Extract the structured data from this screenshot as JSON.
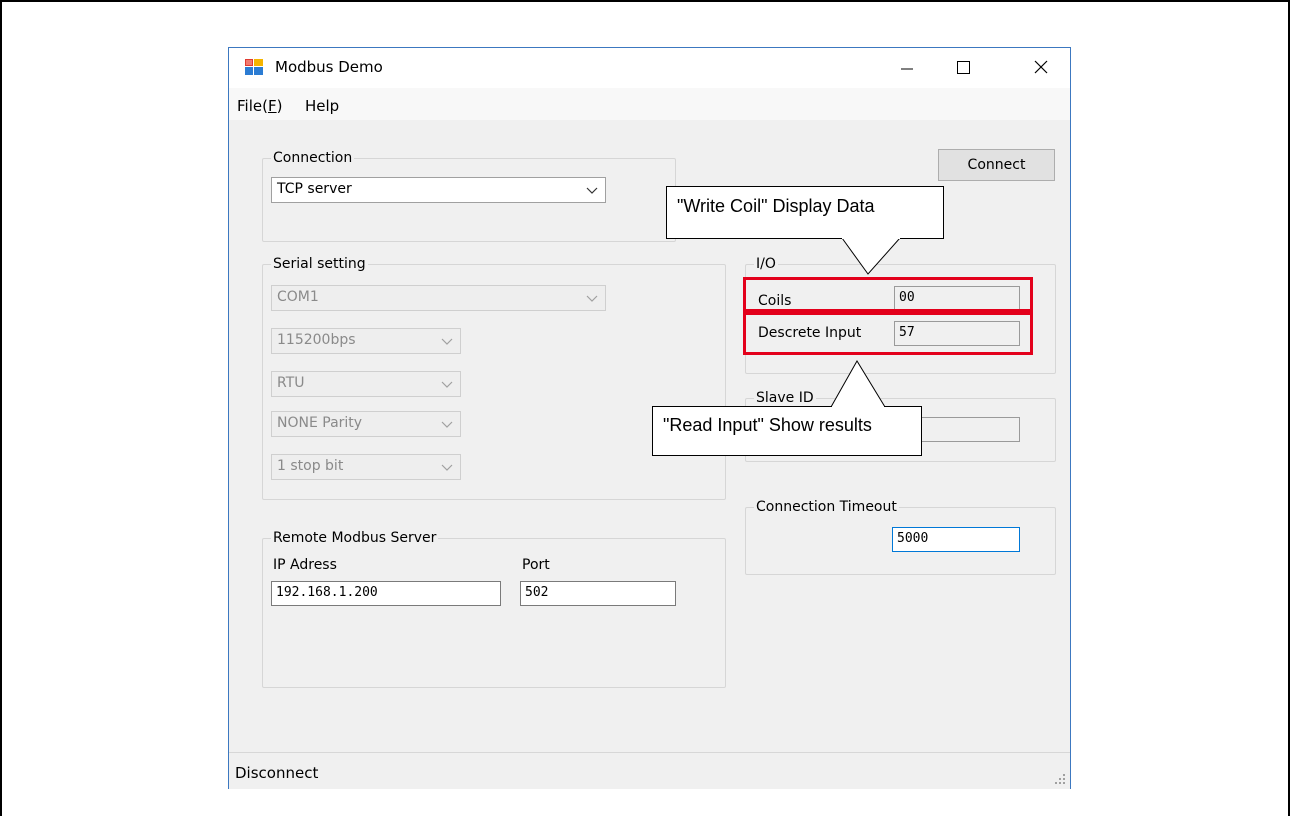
{
  "window": {
    "title": "Modbus Demo",
    "controls": [
      "minimize",
      "maximize",
      "close"
    ]
  },
  "menu": {
    "file_label": "File(F)",
    "file_prefix": "File(",
    "file_accel": "F",
    "file_suffix": ")",
    "help_label": "Help"
  },
  "connection": {
    "group_title": "Connection",
    "selected": "TCP server",
    "connect_button": "Connect"
  },
  "serial": {
    "group_title": "Serial setting",
    "port": "COM1",
    "baud": "115200bps",
    "mode": "RTU",
    "parity": "NONE Parity",
    "stop_bits": "1 stop bit"
  },
  "remote": {
    "group_title": "Remote Modbus Server",
    "ip_label": "IP Adress",
    "ip_value": "192.168.1.200",
    "port_label": "Port",
    "port_value": "502"
  },
  "io": {
    "group_title": "I/O",
    "coils_label": "Coils",
    "coils_value": "00",
    "input_label": "Descrete Input",
    "input_value": "57"
  },
  "slave": {
    "group_title": "Slave ID",
    "value": ""
  },
  "timeout": {
    "group_title": "Connection Timeout",
    "value": "5000"
  },
  "status": {
    "text": "Disconnect"
  },
  "annotations": {
    "write_coil": "\"Write Coil\" Display Data",
    "read_input": "\"Read Input\" Show results",
    "highlight_color": "#e3001b"
  },
  "icons": {
    "app": "app-window-icon",
    "dropdown": "chevron-down-icon",
    "grip": "size-grip-icon"
  }
}
